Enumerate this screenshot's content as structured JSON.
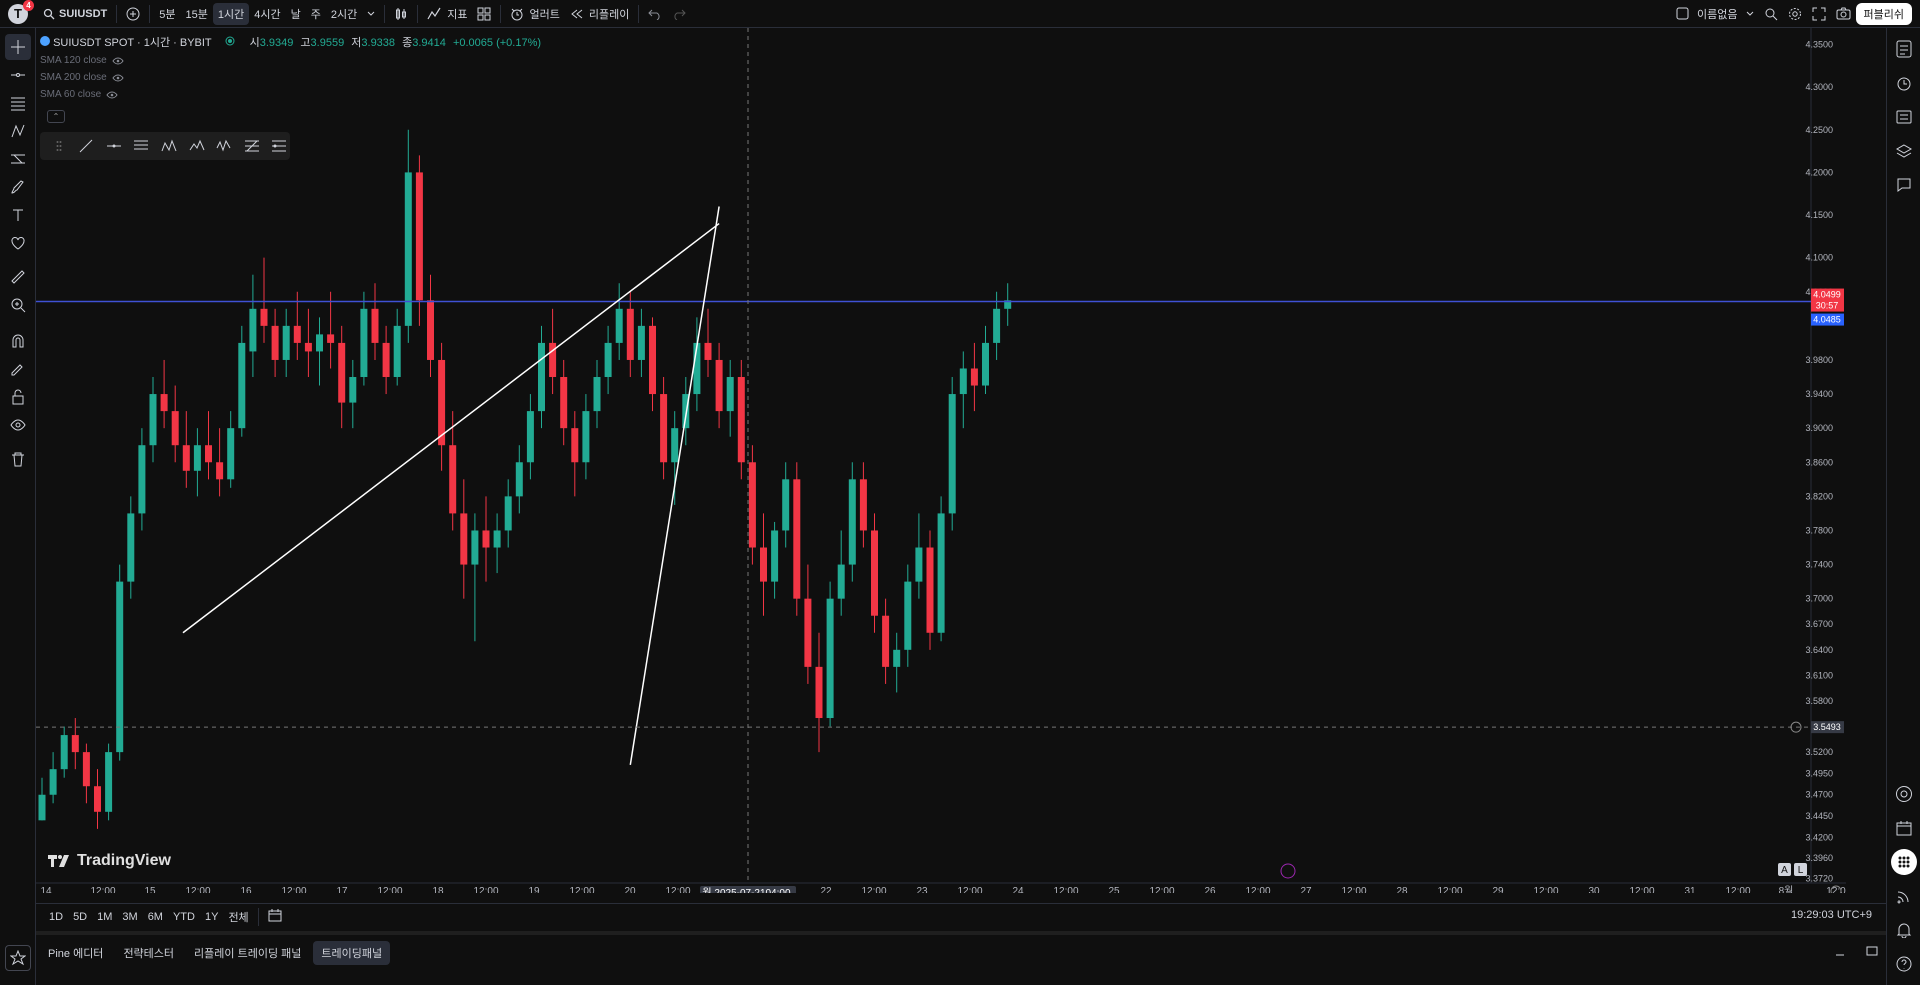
{
  "topbar": {
    "notif_count": "4",
    "symbol": "SUIUSDT",
    "intervals": [
      "5분",
      "15분",
      "1시간",
      "4시간",
      "날",
      "주",
      "2시간"
    ],
    "active_interval": "1시간",
    "indicators_label": "지표",
    "alert_label": "얼러트",
    "replay_label": "리플레이",
    "layout_name": "이름없음",
    "publish_label": "퍼블리쉬"
  },
  "legend": {
    "title": "SUIUSDT SPOT · 1시간 · BYBIT",
    "o_label": "시",
    "o": "3.9349",
    "h_label": "고",
    "h": "3.9559",
    "l_label": "저",
    "l": "3.9338",
    "c_label": "종",
    "c": "3.9414",
    "change": "+0.0065 (+0.17%)",
    "indicators": [
      "SMA 120 close",
      "SMA 200 close",
      "SMA 60 close"
    ]
  },
  "chart_data": {
    "type": "candlestick",
    "symbol": "SUIUSDT",
    "exchange": "BYBIT",
    "interval": "1h",
    "y_ticks": [
      "4.3500",
      "4.3000",
      "4.2500",
      "4.2000",
      "4.1500",
      "4.1000",
      "4.0600",
      "3.9800",
      "3.9400",
      "3.9000",
      "3.8600",
      "3.8200",
      "3.7800",
      "3.7400",
      "3.7000",
      "3.6700",
      "3.6400",
      "3.6100",
      "3.5800",
      "3.5200",
      "3.4950",
      "3.4700",
      "3.4450",
      "3.4200",
      "3.3960",
      "3.3720"
    ],
    "ylim": [
      3.37,
      4.36
    ],
    "x_ticks": [
      "14",
      "12:00",
      "15",
      "12:00",
      "16",
      "12:00",
      "17",
      "12:00",
      "18",
      "12:00",
      "19",
      "12:00",
      "20",
      "12:00",
      "04:00",
      "22",
      "12:00",
      "23",
      "12:00",
      "24",
      "12:00",
      "25",
      "12:00",
      "26",
      "12:00",
      "27",
      "12:00",
      "28",
      "12:00",
      "29",
      "12:00",
      "30",
      "12:00",
      "31",
      "12:00",
      "8월",
      "12:0"
    ],
    "crosshair_x_label": "월 2025-07-21",
    "crosshair_y_label": "3.5493",
    "crosshair_price": 3.5493,
    "horizontal_line": 4.0485,
    "last_price_label": "4.0499",
    "countdown_label": "30:57",
    "hline_label": "4.0485",
    "candles": [
      [
        3.44,
        3.49,
        3.44,
        3.47
      ],
      [
        3.47,
        3.52,
        3.46,
        3.5
      ],
      [
        3.5,
        3.55,
        3.49,
        3.54
      ],
      [
        3.54,
        3.56,
        3.5,
        3.52
      ],
      [
        3.52,
        3.53,
        3.46,
        3.48
      ],
      [
        3.48,
        3.5,
        3.43,
        3.45
      ],
      [
        3.45,
        3.53,
        3.44,
        3.52
      ],
      [
        3.52,
        3.74,
        3.51,
        3.72
      ],
      [
        3.72,
        3.82,
        3.7,
        3.8
      ],
      [
        3.8,
        3.9,
        3.78,
        3.88
      ],
      [
        3.88,
        3.96,
        3.86,
        3.94
      ],
      [
        3.94,
        3.98,
        3.9,
        3.92
      ],
      [
        3.92,
        3.95,
        3.86,
        3.88
      ],
      [
        3.88,
        3.92,
        3.83,
        3.85
      ],
      [
        3.85,
        3.9,
        3.82,
        3.88
      ],
      [
        3.88,
        3.92,
        3.84,
        3.86
      ],
      [
        3.86,
        3.9,
        3.82,
        3.84
      ],
      [
        3.84,
        3.92,
        3.83,
        3.9
      ],
      [
        3.9,
        4.02,
        3.89,
        4.0
      ],
      [
        3.99,
        4.08,
        3.96,
        4.04
      ],
      [
        4.04,
        4.1,
        4.0,
        4.02
      ],
      [
        4.02,
        4.04,
        3.96,
        3.98
      ],
      [
        3.98,
        4.04,
        3.96,
        4.02
      ],
      [
        4.02,
        4.06,
        3.98,
        4.0
      ],
      [
        4.0,
        4.04,
        3.96,
        3.99
      ],
      [
        3.99,
        4.03,
        3.95,
        4.01
      ],
      [
        4.01,
        4.06,
        3.97,
        4.0
      ],
      [
        4.0,
        4.02,
        3.9,
        3.93
      ],
      [
        3.93,
        3.98,
        3.9,
        3.96
      ],
      [
        3.96,
        4.06,
        3.95,
        4.04
      ],
      [
        4.04,
        4.07,
        3.98,
        4.0
      ],
      [
        4.0,
        4.02,
        3.94,
        3.96
      ],
      [
        3.96,
        4.04,
        3.95,
        4.02
      ],
      [
        4.02,
        4.25,
        4.0,
        4.2
      ],
      [
        4.2,
        4.22,
        4.02,
        4.05
      ],
      [
        4.05,
        4.08,
        3.96,
        3.98
      ],
      [
        3.98,
        4.0,
        3.85,
        3.88
      ],
      [
        3.88,
        3.92,
        3.78,
        3.8
      ],
      [
        3.8,
        3.84,
        3.7,
        3.74
      ],
      [
        3.74,
        3.8,
        3.65,
        3.78
      ],
      [
        3.78,
        3.82,
        3.72,
        3.76
      ],
      [
        3.76,
        3.8,
        3.73,
        3.78
      ],
      [
        3.78,
        3.84,
        3.76,
        3.82
      ],
      [
        3.82,
        3.88,
        3.8,
        3.86
      ],
      [
        3.86,
        3.94,
        3.84,
        3.92
      ],
      [
        3.92,
        4.02,
        3.9,
        4.0
      ],
      [
        4.0,
        4.04,
        3.94,
        3.96
      ],
      [
        3.96,
        3.98,
        3.88,
        3.9
      ],
      [
        3.9,
        3.92,
        3.82,
        3.86
      ],
      [
        3.86,
        3.94,
        3.84,
        3.92
      ],
      [
        3.92,
        3.98,
        3.9,
        3.96
      ],
      [
        3.96,
        4.02,
        3.94,
        4.0
      ],
      [
        4.0,
        4.07,
        3.98,
        4.04
      ],
      [
        4.04,
        4.06,
        3.96,
        3.98
      ],
      [
        3.98,
        4.04,
        3.96,
        4.02
      ],
      [
        4.02,
        4.03,
        3.92,
        3.94
      ],
      [
        3.94,
        3.96,
        3.84,
        3.86
      ],
      [
        3.86,
        3.92,
        3.81,
        3.9
      ],
      [
        3.9,
        3.96,
        3.88,
        3.94
      ],
      [
        3.94,
        4.03,
        3.92,
        4.0
      ],
      [
        4.0,
        4.04,
        3.96,
        3.98
      ],
      [
        3.98,
        4.0,
        3.9,
        3.92
      ],
      [
        3.92,
        3.98,
        3.89,
        3.96
      ],
      [
        3.96,
        3.98,
        3.84,
        3.86
      ],
      [
        3.86,
        3.88,
        3.74,
        3.76
      ],
      [
        3.76,
        3.8,
        3.68,
        3.72
      ],
      [
        3.72,
        3.79,
        3.7,
        3.78
      ],
      [
        3.78,
        3.86,
        3.76,
        3.84
      ],
      [
        3.84,
        3.86,
        3.68,
        3.7
      ],
      [
        3.7,
        3.74,
        3.6,
        3.62
      ],
      [
        3.62,
        3.66,
        3.52,
        3.56
      ],
      [
        3.56,
        3.72,
        3.55,
        3.7
      ],
      [
        3.7,
        3.78,
        3.68,
        3.74
      ],
      [
        3.74,
        3.86,
        3.72,
        3.84
      ],
      [
        3.84,
        3.86,
        3.76,
        3.78
      ],
      [
        3.78,
        3.8,
        3.66,
        3.68
      ],
      [
        3.68,
        3.7,
        3.6,
        3.62
      ],
      [
        3.62,
        3.66,
        3.59,
        3.64
      ],
      [
        3.64,
        3.74,
        3.62,
        3.72
      ],
      [
        3.72,
        3.8,
        3.7,
        3.76
      ],
      [
        3.76,
        3.78,
        3.64,
        3.66
      ],
      [
        3.66,
        3.82,
        3.65,
        3.8
      ],
      [
        3.8,
        3.96,
        3.78,
        3.94
      ],
      [
        3.94,
        3.99,
        3.9,
        3.97
      ],
      [
        3.97,
        4.0,
        3.92,
        3.95
      ],
      [
        3.95,
        4.02,
        3.94,
        4.0
      ],
      [
        4.0,
        4.06,
        3.98,
        4.04
      ],
      [
        4.04,
        4.07,
        4.02,
        4.05
      ]
    ],
    "trendlines": [
      {
        "name": "upper-channel",
        "from": [
          12.7,
          3.66
        ],
        "to": [
          61.0,
          4.14
        ]
      },
      {
        "name": "lower-channel",
        "from": [
          53.0,
          3.505
        ],
        "to": [
          61.0,
          4.16
        ]
      }
    ]
  },
  "watermark": "TradingView",
  "ranges": [
    "1D",
    "5D",
    "1M",
    "3M",
    "6M",
    "YTD",
    "1Y",
    "전체"
  ],
  "clock": "19:29:03 UTC+9",
  "bottom_tabs": [
    "Pine 에디터",
    "전략테스터",
    "리플레이 트레이딩 패널",
    "트레이딩패널"
  ],
  "active_bottom_tab": "트레이딩패널",
  "scale_buttons": [
    "A",
    "L"
  ],
  "colors": {
    "up": "#22ab94",
    "down": "#f23645",
    "hline": "#3f51d4",
    "trend": "#ffffff",
    "bg": "#0f0f0f"
  }
}
